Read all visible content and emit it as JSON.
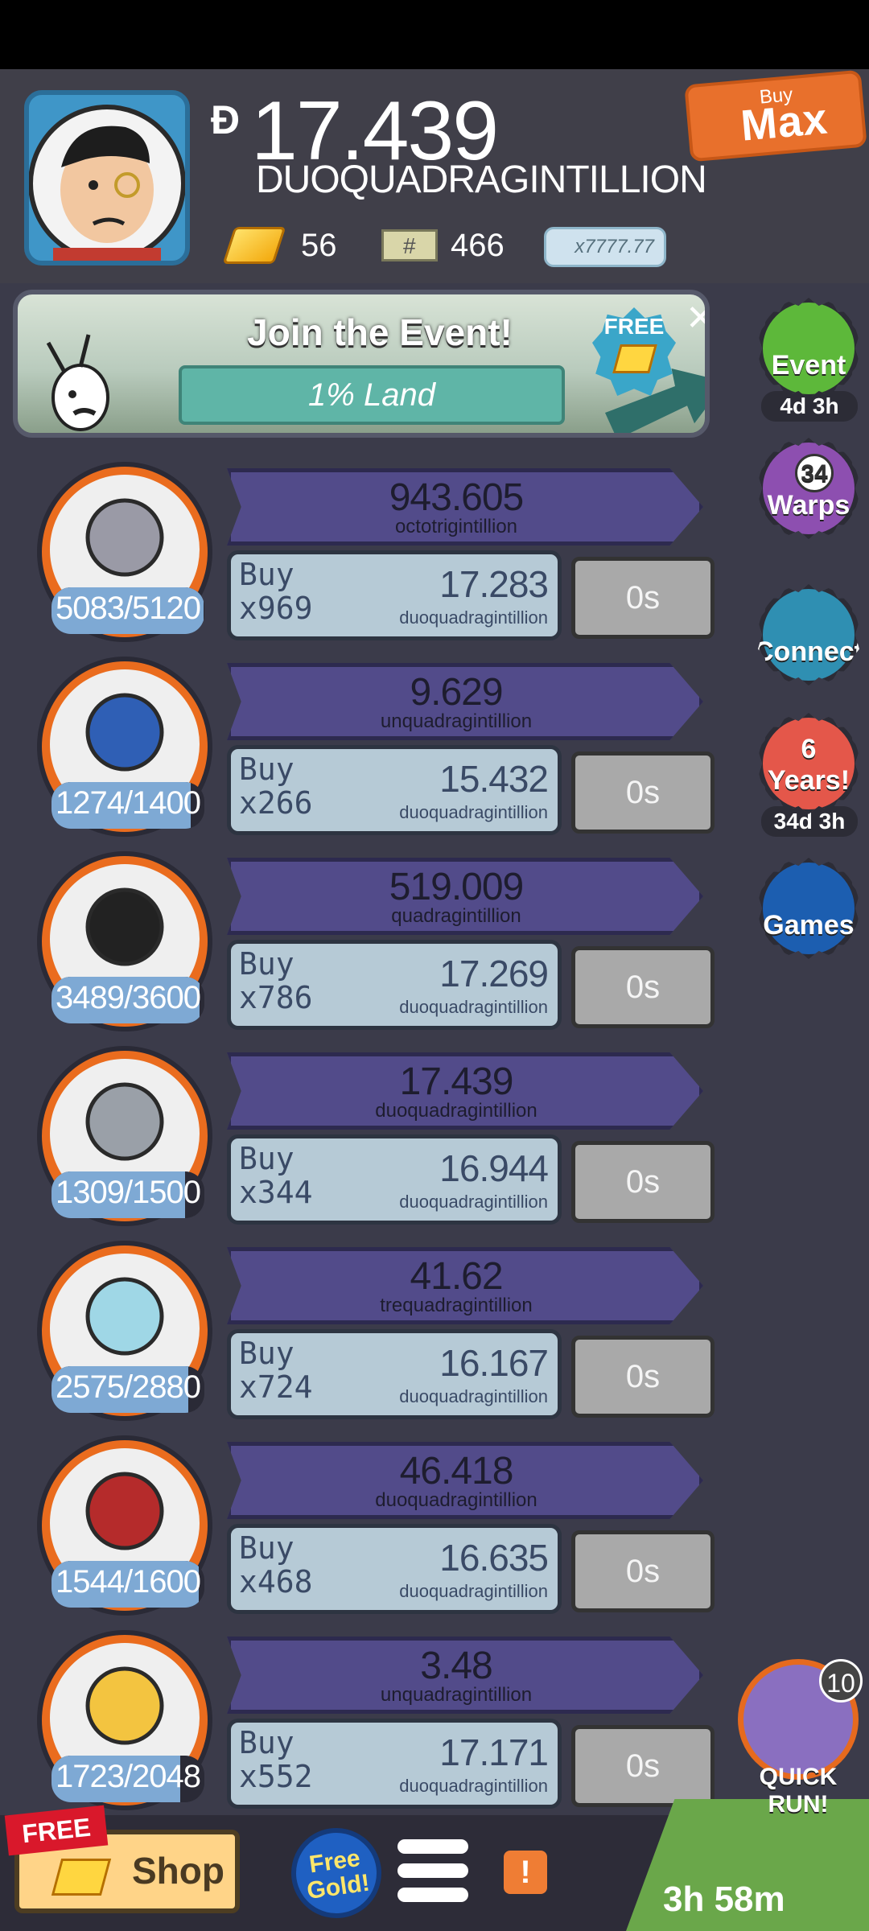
{
  "header": {
    "cash_symbol": "Đ",
    "cash_value": "17.439",
    "cash_unit": "DUOQUADRAGINTILLION",
    "gold": "56",
    "tickets": "466",
    "bill": "x7777.77",
    "buy_small": "Buy",
    "buy_max": "Max"
  },
  "event": {
    "title": "Join the Event!",
    "subtitle": "1% Land",
    "free": "FREE"
  },
  "side": {
    "event_label": "Event",
    "event_time": "4d 3h",
    "warps_count": "34",
    "warps_label": "Warps",
    "connect_label": "Connect",
    "years_label": "6 Years!",
    "years_time": "34d 3h",
    "games_label": "Games"
  },
  "rows": [
    {
      "icon": "moon-boots-icon",
      "count": "5083/5120",
      "progress": 0.993,
      "prod_value": "943.605",
      "prod_unit": "octotrigintillion",
      "buy_qty": "x969",
      "cost_value": "17.283",
      "cost_unit": "duoquadragintillion",
      "timer": "0s"
    },
    {
      "icon": "phone-booth-icon",
      "count": "1274/1400",
      "progress": 0.91,
      "prod_value": "9.629",
      "prod_unit": "unquadragintillion",
      "buy_qty": "x266",
      "cost_value": "15.432",
      "cost_unit": "duoquadragintillion",
      "timer": "0s"
    },
    {
      "icon": "podium-icon",
      "count": "3489/3600",
      "progress": 0.969,
      "prod_value": "519.009",
      "prod_unit": "quadragintillion",
      "buy_qty": "x786",
      "cost_value": "17.269",
      "cost_unit": "duoquadragintillion",
      "timer": "0s"
    },
    {
      "icon": "moon-rocket-icon",
      "count": "1309/1500",
      "progress": 0.873,
      "prod_value": "17.439",
      "prod_unit": "duoquadragintillion",
      "buy_qty": "x344",
      "cost_value": "16.944",
      "cost_unit": "duoquadragintillion",
      "timer": "0s"
    },
    {
      "icon": "martini-glass-icon",
      "count": "2575/2880",
      "progress": 0.894,
      "prod_value": "41.62",
      "prod_unit": "trequadragintillion",
      "buy_qty": "x724",
      "cost_value": "16.167",
      "cost_unit": "duoquadragintillion",
      "timer": "0s"
    },
    {
      "icon": "barn-icon",
      "count": "1544/1600",
      "progress": 0.965,
      "prod_value": "46.418",
      "prod_unit": "duoquadragintillion",
      "buy_qty": "x468",
      "cost_value": "16.635",
      "cost_unit": "duoquadragintillion",
      "timer": "0s"
    },
    {
      "icon": "cheese-cart-icon",
      "count": "1723/2048",
      "progress": 0.841,
      "prod_value": "3.48",
      "prod_unit": "unquadragintillion",
      "buy_qty": "x552",
      "cost_value": "17.171",
      "cost_unit": "duoquadragintillion",
      "timer": "0s"
    }
  ],
  "buy_label": "Buy",
  "bottom": {
    "free_label": "FREE",
    "shop_label": "Shop",
    "free_gold_label": "Free Gold!",
    "alert_symbol": "!",
    "quickrun_count": "10",
    "quickrun_label": "QUICK RUN!",
    "run_timer": "3h 58m"
  },
  "colors": {
    "accent_orange": "#ea6c1e",
    "purple_bar": "#524b8a",
    "buy_blue": "#b6cad6"
  }
}
